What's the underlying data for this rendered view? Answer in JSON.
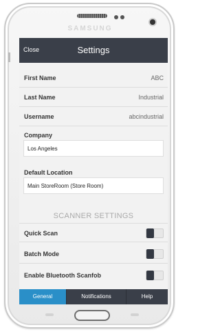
{
  "device": {
    "brand": "SAMSUNG"
  },
  "header": {
    "close_label": "Close",
    "title": "Settings"
  },
  "profile": [
    {
      "label": "First Name",
      "value": "ABC"
    },
    {
      "label": "Last Name",
      "value": "Industrial"
    },
    {
      "label": "Username",
      "value": "abcindustrial"
    }
  ],
  "company": {
    "label": "Company",
    "value": "Los Angeles"
  },
  "default_location": {
    "label": "Default Location",
    "value": "Main StoreRoom (Store Room)"
  },
  "scanner": {
    "section_title": "SCANNER SETTINGS",
    "items": [
      {
        "label": "Quick Scan",
        "enabled": false
      },
      {
        "label": "Batch Mode",
        "enabled": false
      },
      {
        "label": "Enable Bluetooth Scanfob",
        "enabled": false
      }
    ]
  },
  "tabs": [
    {
      "label": "General",
      "active": true
    },
    {
      "label": "Notifications",
      "active": false
    },
    {
      "label": "Help",
      "active": false
    }
  ],
  "colors": {
    "header_bg": "#3a3f49",
    "active_tab": "#2a8fc8",
    "screen_bg": "#f2f2f2"
  }
}
